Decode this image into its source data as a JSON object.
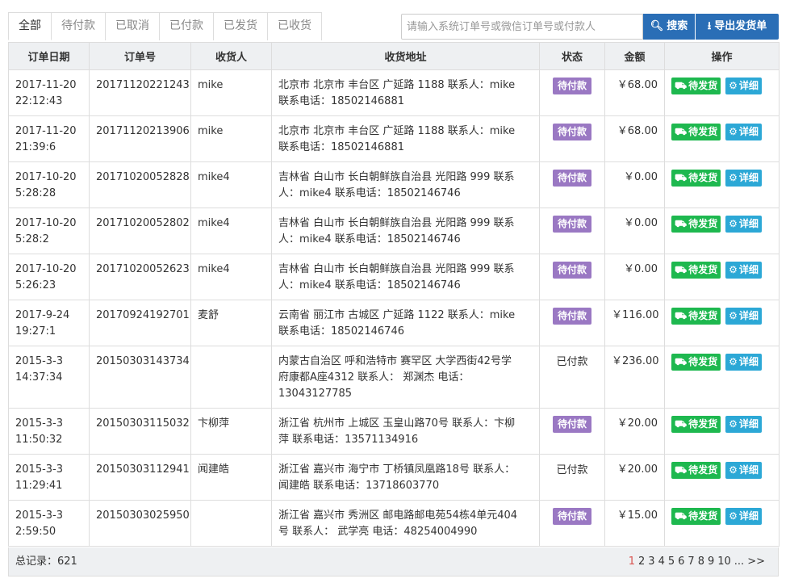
{
  "tabs": [
    "全部",
    "待付款",
    "已取消",
    "已付款",
    "已发货",
    "已收货"
  ],
  "search": {
    "placeholder": "请输入系统订单号或微信订单号或付款人",
    "button_label": "搜索"
  },
  "export_label": "导出发货单",
  "columns": [
    "订单日期",
    "订单号",
    "收货人",
    "收货地址",
    "状态",
    "金额",
    "操作"
  ],
  "colors": {
    "pending_badge": "#9a78c3",
    "ship_button": "#1eb84f",
    "detail_button": "#2ca8d6",
    "primary": "#2a6eb6"
  },
  "actions": {
    "ship": "待发货",
    "detail": "详细"
  },
  "orders": [
    {
      "date": "2017-11-20",
      "time": "22:12:43",
      "order_no": "20171120221243",
      "consignee": "mike",
      "addr1": "北京市 北京市 丰台区 广延路 1188 联系人：mike",
      "addr2": "联系电话：18502146881",
      "addr3": "",
      "status": "待付款",
      "badge": true,
      "amount": "￥68.00"
    },
    {
      "date": "2017-11-20",
      "time": "21:39:6",
      "order_no": "20171120213906",
      "consignee": "mike",
      "addr1": "北京市 北京市 丰台区 广延路 1188 联系人：mike",
      "addr2": "联系电话：18502146881",
      "addr3": "",
      "status": "待付款",
      "badge": true,
      "amount": "￥68.00"
    },
    {
      "date": "2017-10-20",
      "time": "5:28:28",
      "order_no": "20171020052828",
      "consignee": "mike4",
      "addr1": "吉林省 白山市 长白朝鲜族自治县 光阳路 999 联系",
      "addr2": "人：mike4 联系电话：18502146746",
      "addr3": "",
      "status": "待付款",
      "badge": true,
      "amount": "￥0.00"
    },
    {
      "date": "2017-10-20",
      "time": "5:28:2",
      "order_no": "20171020052802",
      "consignee": "mike4",
      "addr1": "吉林省 白山市 长白朝鲜族自治县 光阳路 999 联系",
      "addr2": "人：mike4 联系电话：18502146746",
      "addr3": "",
      "status": "待付款",
      "badge": true,
      "amount": "￥0.00"
    },
    {
      "date": "2017-10-20",
      "time": "5:26:23",
      "order_no": "20171020052623",
      "consignee": "mike4",
      "addr1": "吉林省 白山市 长白朝鲜族自治县 光阳路 999 联系",
      "addr2": "人：mike4 联系电话：18502146746",
      "addr3": "",
      "status": "待付款",
      "badge": true,
      "amount": "￥0.00"
    },
    {
      "date": "2017-9-24",
      "time": "19:27:1",
      "order_no": "20170924192701",
      "consignee": "麦舒",
      "addr1": "云南省 丽江市 古城区 广延路 1122 联系人：mike",
      "addr2": "联系电话：18502146746",
      "addr3": "",
      "status": "待付款",
      "badge": true,
      "amount": "￥116.00"
    },
    {
      "date": "2015-3-3",
      "time": "14:37:34",
      "order_no": "20150303143734",
      "consignee": "",
      "addr1": "内蒙古自治区 呼和浩特市 赛罕区 大学西街42号学",
      "addr2": "府康都A座4312 联系人： 郑渊杰 电话：",
      "addr3": "13043127785",
      "status": "已付款",
      "badge": false,
      "amount": "￥236.00"
    },
    {
      "date": "2015-3-3",
      "time": "11:50:32",
      "order_no": "20150303115032",
      "consignee": "卞柳萍",
      "addr1": "浙江省 杭州市 上城区 玉皇山路70号 联系人：卞柳",
      "addr2": "萍 联系电话：13571134916",
      "addr3": "",
      "status": "待付款",
      "badge": true,
      "amount": "￥20.00"
    },
    {
      "date": "2015-3-3",
      "time": "11:29:41",
      "order_no": "20150303112941",
      "consignee": "闻建皓",
      "addr1": "浙江省 嘉兴市 海宁市 丁桥镇凤凰路18号 联系人：",
      "addr2": "闻建皓 联系电话：13718603770",
      "addr3": "",
      "status": "已付款",
      "badge": false,
      "amount": "￥20.00"
    },
    {
      "date": "2015-3-3",
      "time": "2:59:50",
      "order_no": "20150303025950",
      "consignee": "",
      "addr1": "浙江省 嘉兴市 秀洲区 邮电路邮电苑54栋4单元404",
      "addr2": "号 联系人： 武学亮 电话：48254004990",
      "addr3": "",
      "status": "待付款",
      "badge": true,
      "amount": "￥15.00"
    }
  ],
  "footer": {
    "total_label": "总记录：621",
    "pages": [
      "1",
      "2",
      "3",
      "4",
      "5",
      "6",
      "7",
      "8",
      "9",
      "10",
      "...",
      ">>"
    ],
    "current_page": "1"
  }
}
